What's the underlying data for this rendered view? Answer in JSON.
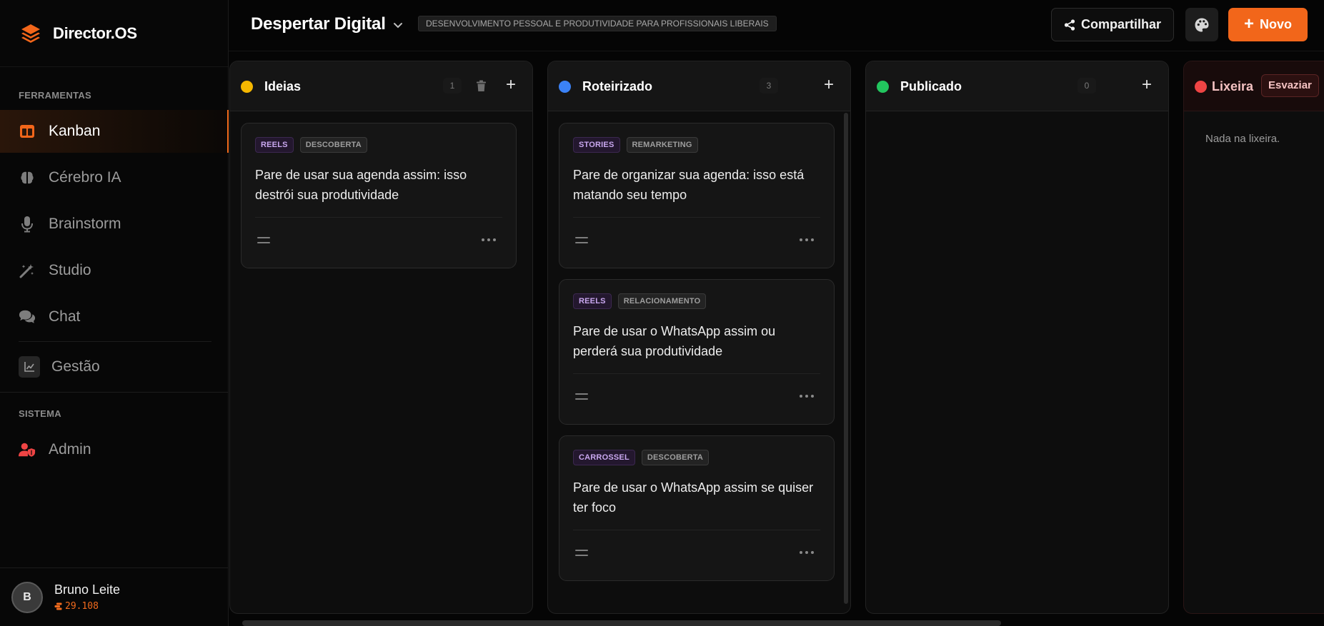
{
  "app": {
    "name": "Director.OS"
  },
  "sidebar": {
    "sections": [
      {
        "label": "FERRAMENTAS"
      },
      {
        "label": "SISTEMA"
      }
    ],
    "items": [
      {
        "label": "Kanban",
        "icon": "kanban-icon",
        "active": true
      },
      {
        "label": "Cérebro IA",
        "icon": "brain-icon"
      },
      {
        "label": "Brainstorm",
        "icon": "microphone-icon"
      },
      {
        "label": "Studio",
        "icon": "magic-wand-icon"
      },
      {
        "label": "Chat",
        "icon": "chat-icon"
      },
      {
        "label": "Gestão",
        "icon": "chart-line-icon"
      },
      {
        "label": "Admin",
        "icon": "user-shield-icon"
      }
    ],
    "user": {
      "initial": "B",
      "name": "Bruno Leite",
      "credits": "29.108"
    }
  },
  "header": {
    "project_title": "Despertar Digital",
    "project_description": "DESENVOLVIMENTO PESSOAL E PRODUTIVIDADE PARA PROFISSIONAIS LIBERAIS",
    "share_label": "Compartilhar",
    "new_label": "Novo"
  },
  "colors": {
    "accent": "#f2661a",
    "ideias": "#f5b700",
    "roteirizado": "#3b82f6",
    "publicado": "#22c55e",
    "lixeira": "#ef4444"
  },
  "columns": [
    {
      "title": "Ideias",
      "count": "1",
      "cards": [
        {
          "format": "REELS",
          "category": "DESCOBERTA",
          "title": "Pare de usar sua agenda assim: isso destrói sua produtividade"
        }
      ]
    },
    {
      "title": "Roteirizado",
      "count": "3",
      "cards": [
        {
          "format": "STORIES",
          "category": "REMARKETING",
          "title": "Pare de organizar sua agenda: isso está matando seu tempo"
        },
        {
          "format": "REELS",
          "category": "RELACIONAMENTO",
          "title": "Pare de usar o WhatsApp assim ou perderá sua produtividade"
        },
        {
          "format": "CARROSSEL",
          "category": "DESCOBERTA",
          "title": "Pare de usar o WhatsApp assim se quiser ter foco"
        }
      ]
    },
    {
      "title": "Publicado",
      "count": "0",
      "cards": []
    },
    {
      "title": "Lixeira",
      "empty_button": "Esvaziar",
      "empty_text": "Nada na lixeira."
    }
  ]
}
